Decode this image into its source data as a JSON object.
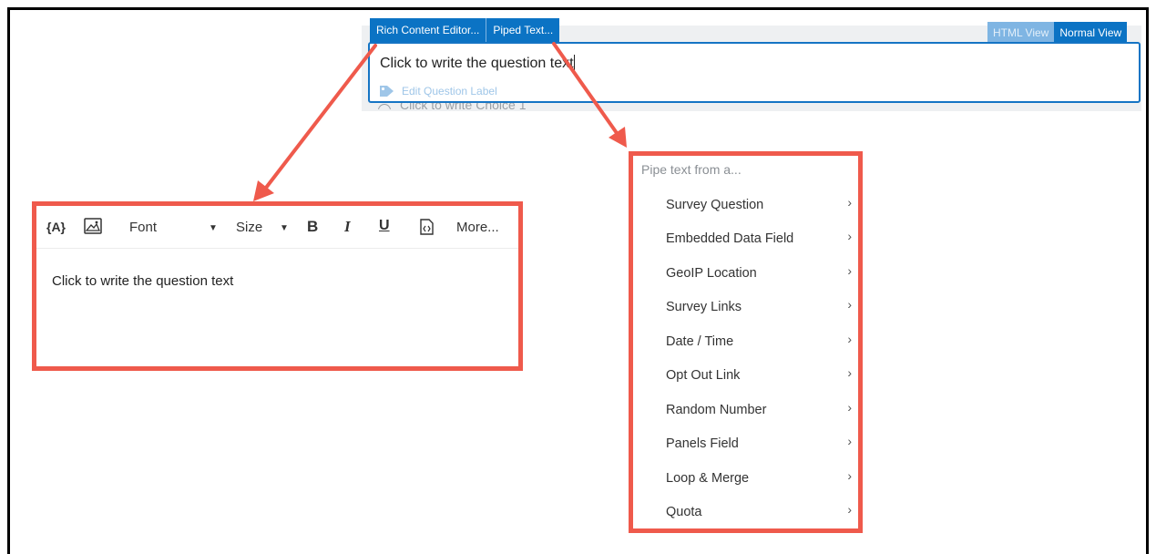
{
  "editor": {
    "tabs": [
      "Rich Content Editor...",
      "Piped Text..."
    ],
    "view_toggle": [
      "HTML View",
      "Normal View"
    ],
    "question_text": "Click to write the question text",
    "question_label": "Edit Question Label",
    "choice_peek": "Click to write Choice 1"
  },
  "rich_editor": {
    "toolbar": {
      "piped_icon": "{A}",
      "font": "Font",
      "size": "Size",
      "bold": "B",
      "italic": "I",
      "underline": "U",
      "more": "More..."
    },
    "body_text": "Click to write the question text"
  },
  "piped_menu": {
    "title": "Pipe text from a...",
    "items": [
      "Survey Question",
      "Embedded Data Field",
      "GeoIP Location",
      "Survey Links",
      "Date / Time",
      "Opt Out Link",
      "Random Number",
      "Panels Field",
      "Loop & Merge",
      "Quota"
    ]
  },
  "colors": {
    "accent_blue": "#0b73c4",
    "annotation_red": "#ef5a4c"
  },
  "icons": [
    "tag-icon",
    "image-icon",
    "dropdown-caret-icon",
    "source-code-icon",
    "chevron-right-icon"
  ]
}
